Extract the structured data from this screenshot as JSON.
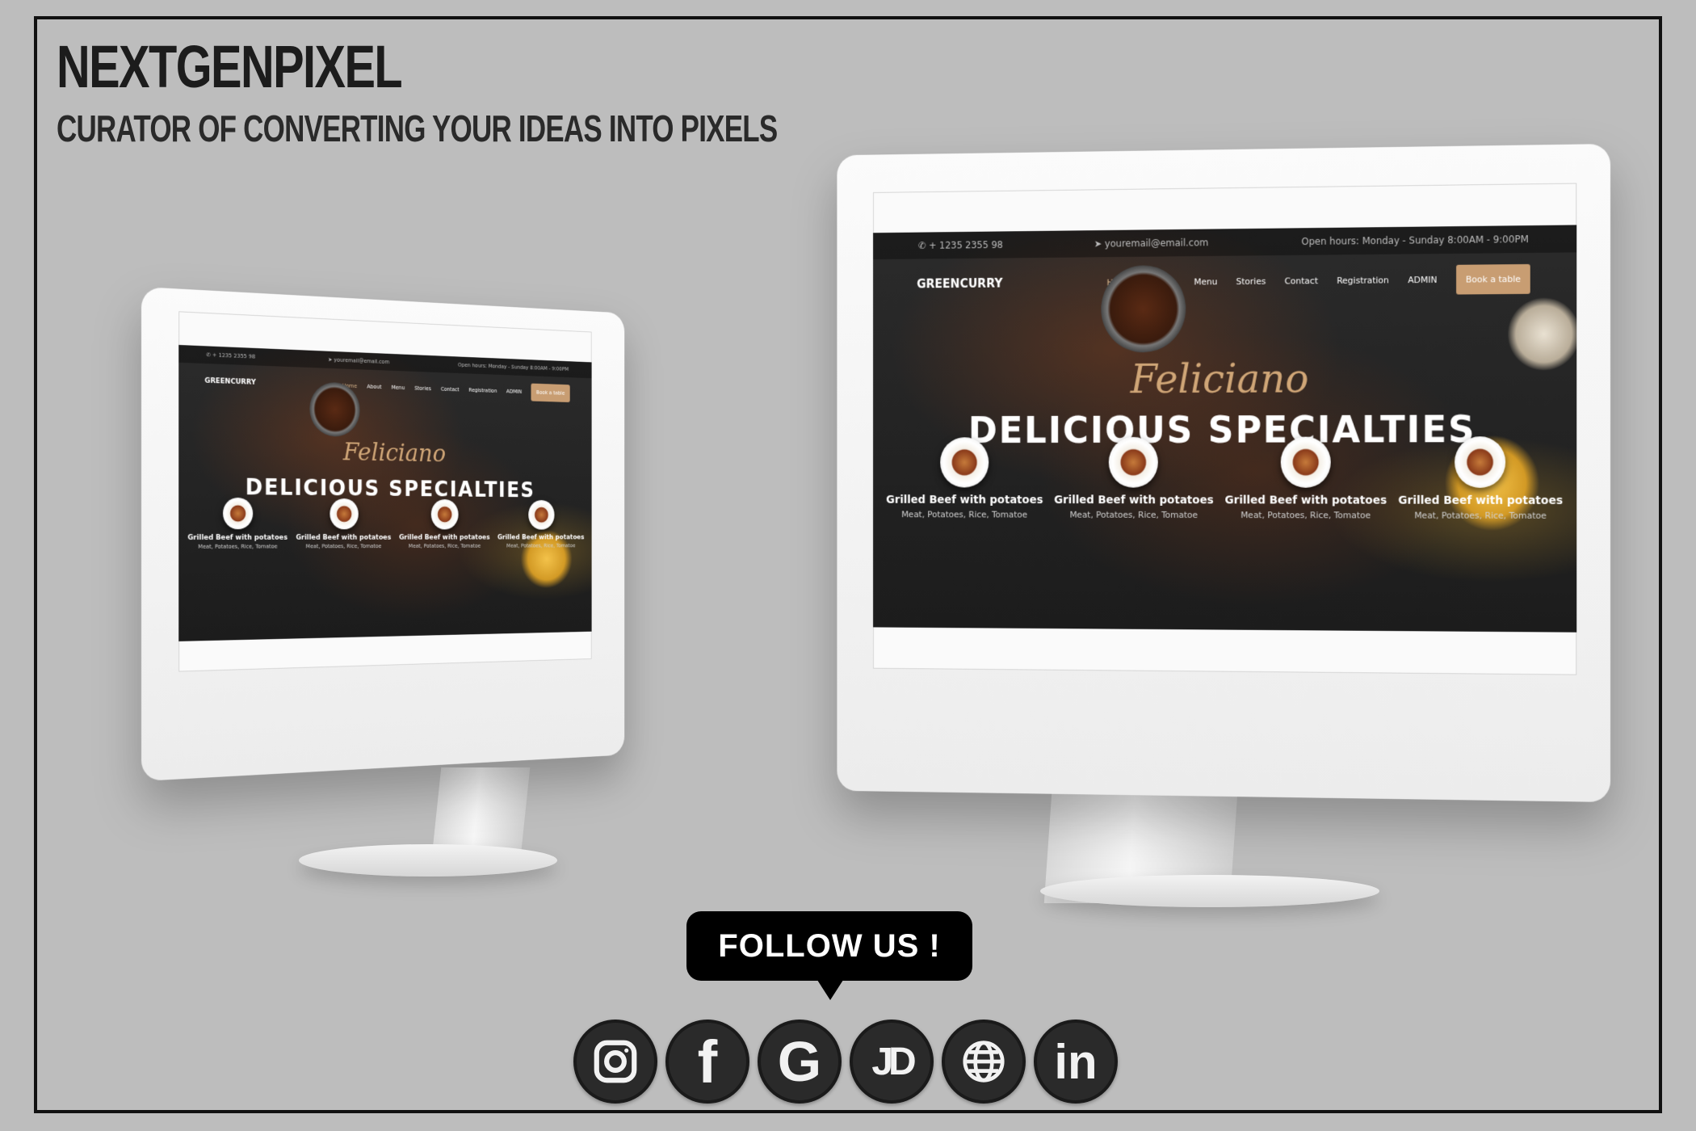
{
  "brand": {
    "title": "NEXTGENPIXEL",
    "tagline": "CURATOR OF CONVERTING YOUR IDEAS INTO PIXELS"
  },
  "website": {
    "topbar": {
      "phone": "+ 1235 2355 98",
      "email": "youremail@email.com",
      "hours": "Open hours: Monday - Sunday 8:00AM - 9:00PM"
    },
    "logo": "GREENCURRY",
    "nav": [
      "Home",
      "About",
      "Menu",
      "Stories",
      "Contact",
      "Registration",
      "ADMIN"
    ],
    "book_button": "Book a table",
    "hero_script": "Feliciano",
    "hero_title": "DELICIOUS SPECIALTIES",
    "dishes": [
      {
        "name": "Grilled Beef with potatoes",
        "desc": "Meat, Potatoes, Rice, Tomatoe"
      },
      {
        "name": "Grilled Beef with potatoes",
        "desc": "Meat, Potatoes, Rice, Tomatoe"
      },
      {
        "name": "Grilled Beef with potatoes",
        "desc": "Meat, Potatoes, Rice, Tomatoe"
      },
      {
        "name": "Grilled Beef with potatoes",
        "desc": "Meat, Potatoes, Rice, Tomatoe"
      }
    ]
  },
  "follow": {
    "label": "FOLLOW US !",
    "socials": [
      {
        "icon": "instagram-icon"
      },
      {
        "icon": "facebook-icon",
        "glyph": "f"
      },
      {
        "icon": "google-icon",
        "glyph": "G"
      },
      {
        "icon": "justdial-icon",
        "glyph": "JD"
      },
      {
        "icon": "globe-icon"
      },
      {
        "icon": "linkedin-icon",
        "glyph": "in"
      }
    ]
  }
}
